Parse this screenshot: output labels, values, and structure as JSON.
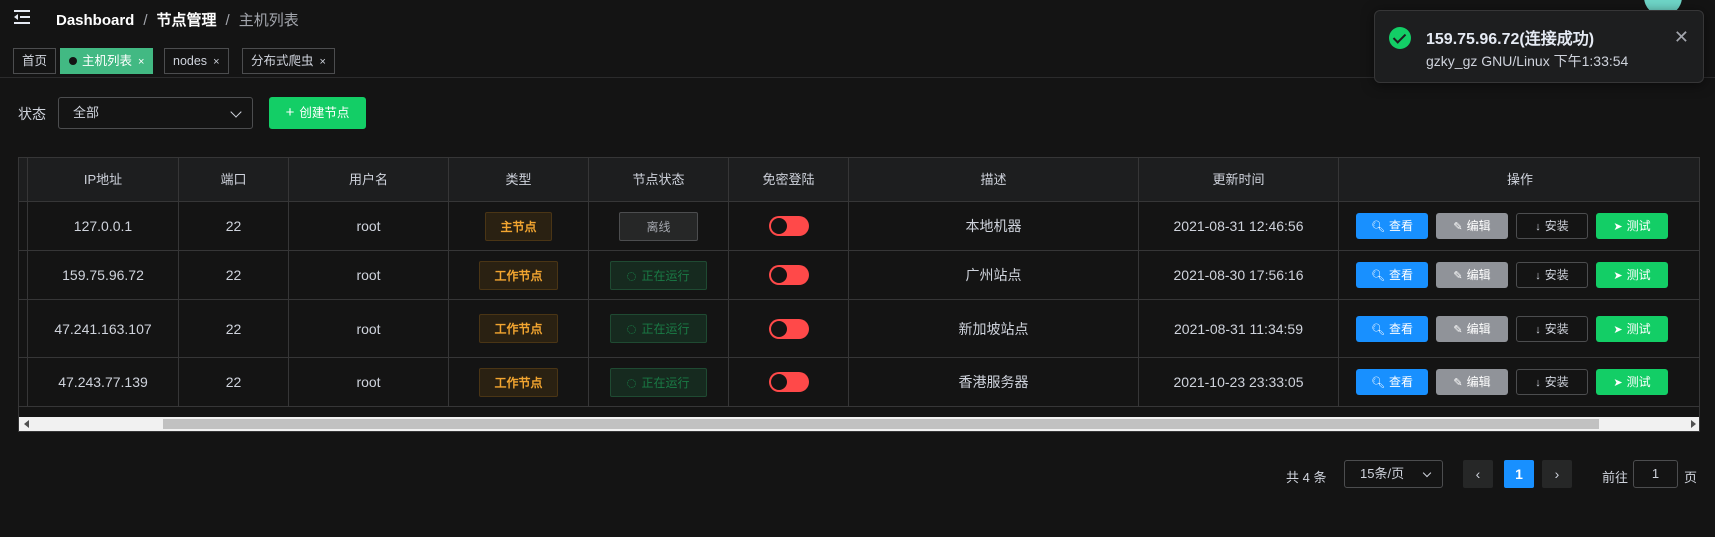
{
  "breadcrumb": [
    "Dashboard",
    "节点管理",
    "主机列表"
  ],
  "tags": [
    {
      "label": "首页",
      "active": false,
      "closable": false
    },
    {
      "label": "主机列表",
      "active": true,
      "closable": true
    },
    {
      "label": "nodes",
      "active": false,
      "closable": true
    },
    {
      "label": "分布式爬虫",
      "active": false,
      "closable": true
    }
  ],
  "filter": {
    "label": "状态",
    "selected": "全部"
  },
  "create_button": "创建节点",
  "table": {
    "columns": [
      "IP地址",
      "端口",
      "用户名",
      "类型",
      "节点状态",
      "免密登陆",
      "描述",
      "更新时间",
      "操作"
    ],
    "rows": [
      {
        "ip": "127.0.0.1",
        "port": "22",
        "user": "root",
        "type": "主节点",
        "status": "离线",
        "nopass": false,
        "desc": "本地机器",
        "updated": "2021-08-31 12:46:56"
      },
      {
        "ip": "159.75.96.72",
        "port": "22",
        "user": "root",
        "type": "工作节点",
        "status": "正在运行",
        "nopass": false,
        "desc": "广州站点",
        "updated": "2021-08-30 17:56:16"
      },
      {
        "ip": "47.241.163.107",
        "port": "22",
        "user": "root",
        "type": "工作节点",
        "status": "正在运行",
        "nopass": false,
        "desc": "新加坡站点",
        "updated": "2021-08-31 11:34:59"
      },
      {
        "ip": "47.243.77.139",
        "port": "22",
        "user": "root",
        "type": "工作节点",
        "status": "正在运行",
        "nopass": false,
        "desc": "香港服务器",
        "updated": "2021-10-23 23:33:05"
      }
    ],
    "actions": {
      "view": "查看",
      "edit": "编辑",
      "install": "安装",
      "test": "测试"
    }
  },
  "pagination": {
    "total_text": "共 4 条",
    "page_size": "15条/页",
    "current_page": "1",
    "goto_prefix": "前往",
    "goto_value": "1",
    "goto_suffix": "页"
  },
  "notification": {
    "title": "159.75.96.72(连接成功)",
    "message": "gzky_gz GNU/Linux 下午1:33:54"
  },
  "colors": {
    "accent": "#42b983",
    "success": "#13ce66",
    "primary": "#1890ff",
    "danger": "#ff4949",
    "warning": "#f2a530"
  }
}
